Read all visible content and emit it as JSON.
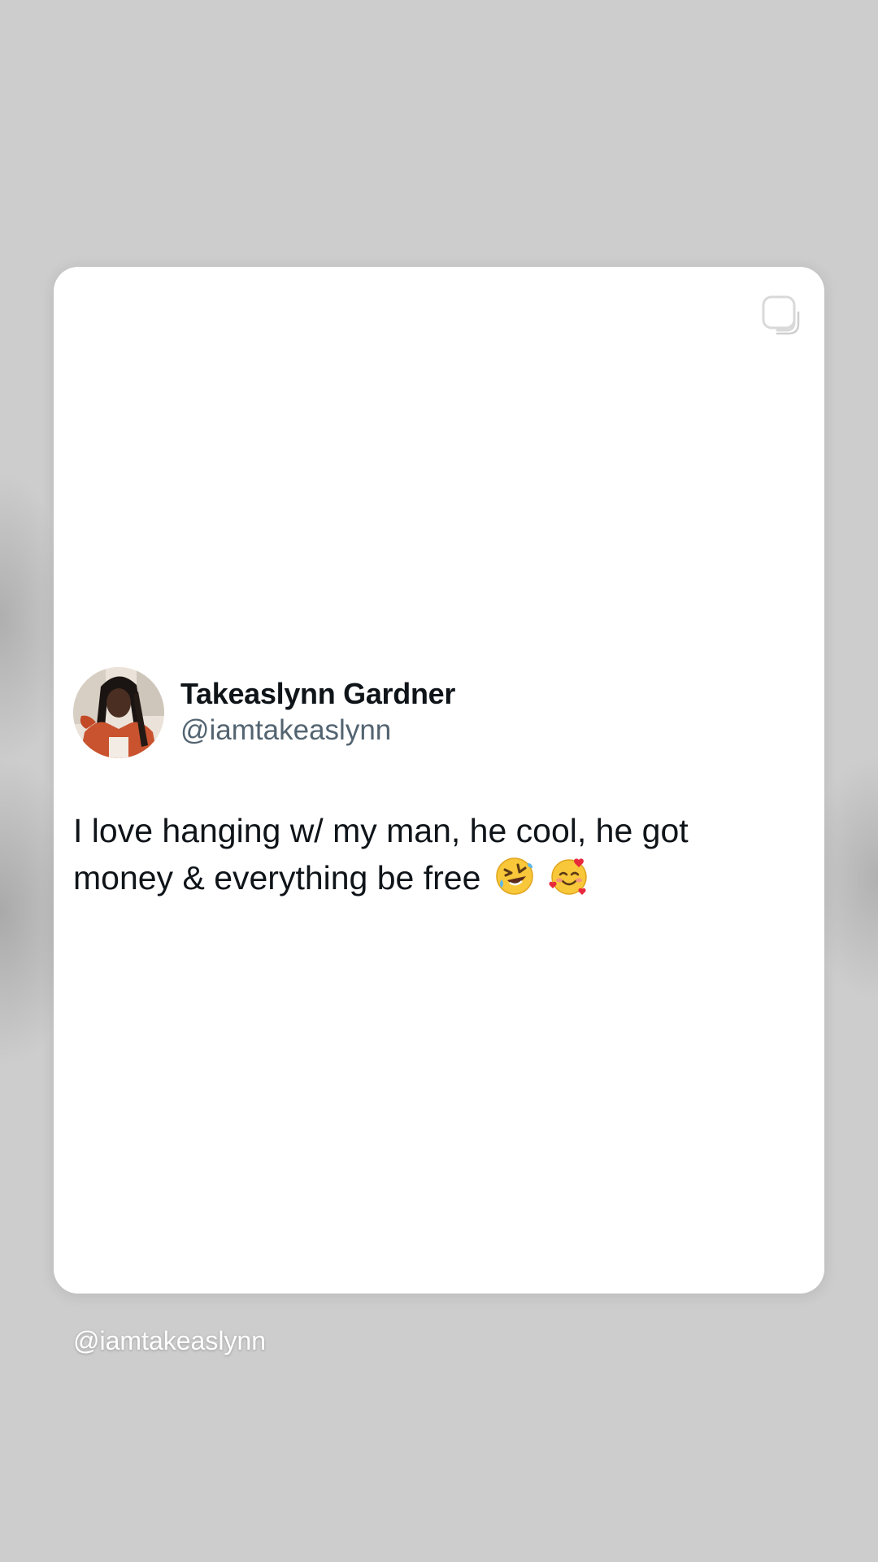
{
  "tweet": {
    "display_name": "Takeaslynn Gardner",
    "handle": "@iamtakeaslynn",
    "text": "I love hanging w/ my man, he cool, he got money & everything be free",
    "emojis": [
      "rolling-on-floor-laughing-emoji",
      "smiling-face-with-hearts-emoji"
    ]
  },
  "overlay": {
    "credit": "@iamtakeaslynn"
  },
  "icons": {
    "sticker": "sticker-icon"
  },
  "colors": {
    "background": "#cdcdcd",
    "card": "#ffffff",
    "name": "#0f1419",
    "handle": "#536471"
  }
}
